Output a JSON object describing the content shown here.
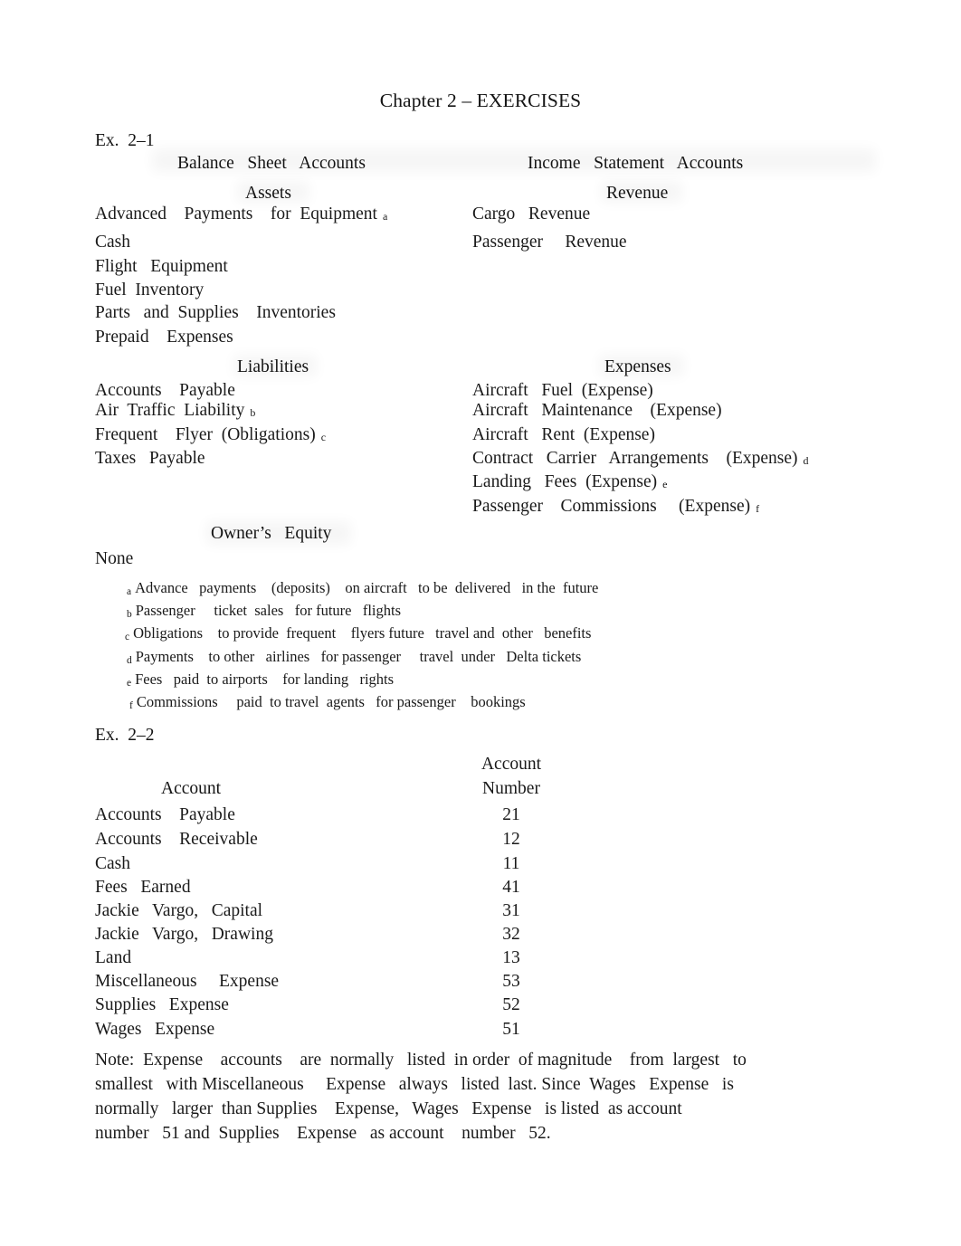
{
  "document": {
    "title": "Chapter 2 – EXERCISES"
  },
  "exercise_1": {
    "label": "Ex.  2–1",
    "columns": {
      "left_heading": "Balance   Sheet   Accounts",
      "right_heading": "Income   Statement   Accounts"
    },
    "sections": {
      "assets": {
        "heading": "Assets",
        "items": [
          {
            "text": "Advanced    Payments    for  Equipment",
            "mark": "a"
          },
          {
            "text": "Cash",
            "mark": ""
          },
          {
            "text": "Flight   Equipment",
            "mark": ""
          },
          {
            "text": "Fuel  Inventory",
            "mark": ""
          },
          {
            "text": "Parts   and  Supplies    Inventories",
            "mark": ""
          },
          {
            "text": "Prepaid    Expenses",
            "mark": ""
          }
        ]
      },
      "revenue": {
        "heading": "Revenue",
        "items": [
          {
            "text": "Cargo   Revenue",
            "mark": ""
          },
          {
            "text": "Passenger     Revenue",
            "mark": ""
          }
        ]
      },
      "liabilities": {
        "heading": "Liabilities",
        "items": [
          {
            "text": "Accounts    Payable",
            "mark": ""
          },
          {
            "text": "Air  Traffic  Liability",
            "mark": "b"
          },
          {
            "text": "Frequent    Flyer  (Obligations)",
            "mark": "c"
          },
          {
            "text": "Taxes   Payable",
            "mark": ""
          }
        ]
      },
      "expenses": {
        "heading": "Expenses",
        "items": [
          {
            "text": "Aircraft   Fuel  (Expense)",
            "mark": ""
          },
          {
            "text": "Aircraft   Maintenance    (Expense)",
            "mark": ""
          },
          {
            "text": "Aircraft   Rent  (Expense)",
            "mark": ""
          },
          {
            "text": "Contract   Carrier   Arrangements    (Expense)",
            "mark": "d"
          },
          {
            "text": "Landing   Fees  (Expense)",
            "mark": "e"
          },
          {
            "text": "Passenger    Commissions     (Expense)",
            "mark": "f"
          }
        ]
      },
      "owners_equity": {
        "heading": "Owner’s   Equity",
        "items": [
          {
            "text": "None",
            "mark": ""
          }
        ]
      }
    },
    "footnotes": [
      {
        "marker": "a",
        "text": "Advance   payments    (deposits)    on aircraft   to be  delivered   in the  future"
      },
      {
        "marker": "b",
        "text": "Passenger     ticket  sales   for future   flights"
      },
      {
        "marker": "c",
        "text": "Obligations    to provide  frequent    flyers future   travel and  other   benefits"
      },
      {
        "marker": "d",
        "text": "Payments    to other   airlines   for passenger     travel  under   Delta tickets"
      },
      {
        "marker": "e",
        "text": "Fees   paid  to airports    for landing   rights"
      },
      {
        "marker": "f",
        "text": "Commissions     paid  to travel  agents   for passenger    bookings"
      }
    ]
  },
  "exercise_2": {
    "label": "Ex.  2–2",
    "table": {
      "header_line_1": "Account",
      "header_col_name": "Account",
      "header_col_number": "Number",
      "rows": [
        {
          "account": "Accounts    Payable",
          "number": "21"
        },
        {
          "account": "Accounts    Receivable",
          "number": "12"
        },
        {
          "account": "Cash",
          "number": "11"
        },
        {
          "account": "Fees   Earned",
          "number": "41"
        },
        {
          "account": "Jackie   Vargo,   Capital",
          "number": "31"
        },
        {
          "account": "Jackie   Vargo,   Drawing",
          "number": "32"
        },
        {
          "account": "Land",
          "number": "13"
        },
        {
          "account": "Miscellaneous     Expense",
          "number": "53"
        },
        {
          "account": "Supplies   Expense",
          "number": "52"
        },
        {
          "account": "Wages   Expense",
          "number": "51"
        }
      ]
    },
    "note_lines": [
      "Note:  Expense    accounts    are  normally   listed  in order  of magnitude    from  largest   to",
      "smallest   with Miscellaneous     Expense   always   listed  last. Since  Wages   Expense   is",
      "normally   larger  than Supplies    Expense,   Wages   Expense   is listed  as account",
      "number   51 and  Supplies    Expense   as account    number   52."
    ]
  }
}
